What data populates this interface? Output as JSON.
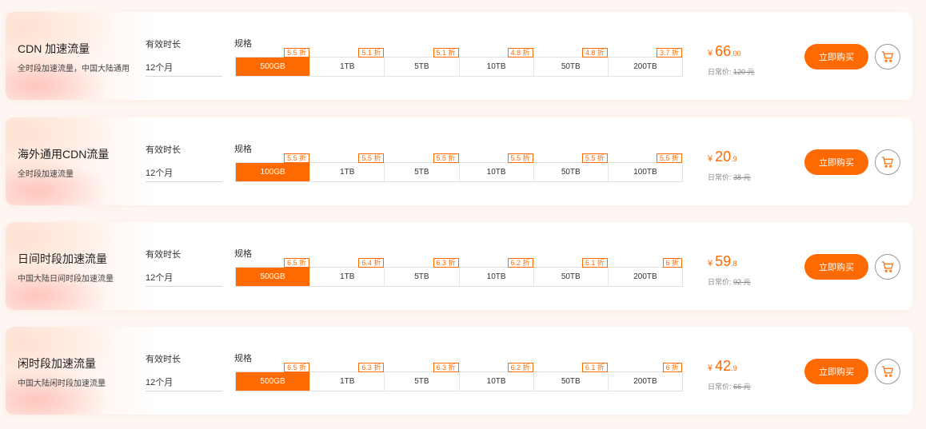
{
  "colors": {
    "accent": "#ff6a00",
    "page_bg": "#fdf6f2",
    "card_bg": "#ffffff"
  },
  "cards": [
    {
      "name": "CDN 加速流量",
      "desc": "全时段加速流量，中国大陆通用",
      "duration_label": "有效时长",
      "duration_value": "12个月",
      "spec_label": "规格",
      "options": [
        {
          "label": "500GB",
          "discount": "5.5 折",
          "selected": true
        },
        {
          "label": "1TB",
          "discount": "5.1 折",
          "selected": false
        },
        {
          "label": "5TB",
          "discount": "5.1 折",
          "selected": false
        },
        {
          "label": "10TB",
          "discount": "4.8 折",
          "selected": false
        },
        {
          "label": "50TB",
          "discount": "4.8 折",
          "selected": false
        },
        {
          "label": "200TB",
          "discount": "3.7 折",
          "selected": false
        }
      ],
      "price_currency": "¥",
      "price_int": "66",
      "price_dec": ".00",
      "orig_label": "日常价:",
      "orig_value": "120 元",
      "buy_label": "立即购买",
      "cart_icon": "shopping-cart-icon"
    },
    {
      "name": "海外通用CDN流量",
      "desc": "全时段加速流量",
      "duration_label": "有效时长",
      "duration_value": "12个月",
      "spec_label": "规格",
      "options": [
        {
          "label": "100GB",
          "discount": "5.5 折",
          "selected": true
        },
        {
          "label": "1TB",
          "discount": "5.5 折",
          "selected": false
        },
        {
          "label": "5TB",
          "discount": "5.5 折",
          "selected": false
        },
        {
          "label": "10TB",
          "discount": "5.5 折",
          "selected": false
        },
        {
          "label": "50TB",
          "discount": "5.5 折",
          "selected": false
        },
        {
          "label": "100TB",
          "discount": "5.5 折",
          "selected": false
        }
      ],
      "price_currency": "¥",
      "price_int": "20",
      "price_dec": ".9",
      "orig_label": "日常价:",
      "orig_value": "38 元",
      "buy_label": "立即购买",
      "cart_icon": "shopping-cart-icon"
    },
    {
      "name": "日间时段加速流量",
      "desc": "中国大陆日间时段加速流量",
      "duration_label": "有效时长",
      "duration_value": "12个月",
      "spec_label": "规格",
      "options": [
        {
          "label": "500GB",
          "discount": "6.5 折",
          "selected": true
        },
        {
          "label": "1TB",
          "discount": "6.4 折",
          "selected": false
        },
        {
          "label": "5TB",
          "discount": "6.3 折",
          "selected": false
        },
        {
          "label": "10TB",
          "discount": "6.2 折",
          "selected": false
        },
        {
          "label": "50TB",
          "discount": "6.1 折",
          "selected": false
        },
        {
          "label": "200TB",
          "discount": "6 折",
          "selected": false
        }
      ],
      "price_currency": "¥",
      "price_int": "59",
      "price_dec": ".8",
      "orig_label": "日常价:",
      "orig_value": "92 元",
      "buy_label": "立即购买",
      "cart_icon": "shopping-cart-icon"
    },
    {
      "name": "闲时段加速流量",
      "desc": "中国大陆闲时段加速流量",
      "duration_label": "有效时长",
      "duration_value": "12个月",
      "spec_label": "规格",
      "options": [
        {
          "label": "500GB",
          "discount": "6.5 折",
          "selected": true
        },
        {
          "label": "1TB",
          "discount": "6.3 折",
          "selected": false
        },
        {
          "label": "5TB",
          "discount": "6.3 折",
          "selected": false
        },
        {
          "label": "10TB",
          "discount": "6.2 折",
          "selected": false
        },
        {
          "label": "50TB",
          "discount": "6.1 折",
          "selected": false
        },
        {
          "label": "200TB",
          "discount": "6 折",
          "selected": false
        }
      ],
      "price_currency": "¥",
      "price_int": "42",
      "price_dec": ".9",
      "orig_label": "日常价:",
      "orig_value": "66 元",
      "buy_label": "立即购买",
      "cart_icon": "shopping-cart-icon"
    }
  ]
}
